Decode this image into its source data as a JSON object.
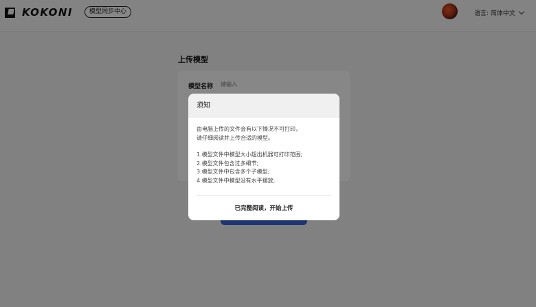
{
  "header": {
    "logo_text": "KOKONI",
    "sync_center_label": "模型同步中心",
    "language_label": "语言: 简体中文"
  },
  "page": {
    "title": "上传模型",
    "form": {
      "model_name_label": "模型名称",
      "model_name_placeholder": "请输入"
    }
  },
  "modal": {
    "title": "须知",
    "intro_lines": [
      "由电脑上传的文件会有以下情况不可打印，",
      "请仔细阅读并上传合适的模型。"
    ],
    "rules": [
      "1.模型文件中模型大小超出机器可打印范围;",
      "2.模型文件包含过多细节;",
      "3.模型文件中包含多个子模型;",
      "4.模型文件中模型没有水平摆放;"
    ],
    "confirm_label": "已完整阅读，开始上传"
  },
  "icons": {
    "logo": "kokoni-logo-icon",
    "avatar": "user-avatar",
    "dropdown": "chevron-down-icon"
  },
  "colors": {
    "primary_button": "#3a63d8",
    "overlay": "rgba(0,0,0,0.47)"
  }
}
